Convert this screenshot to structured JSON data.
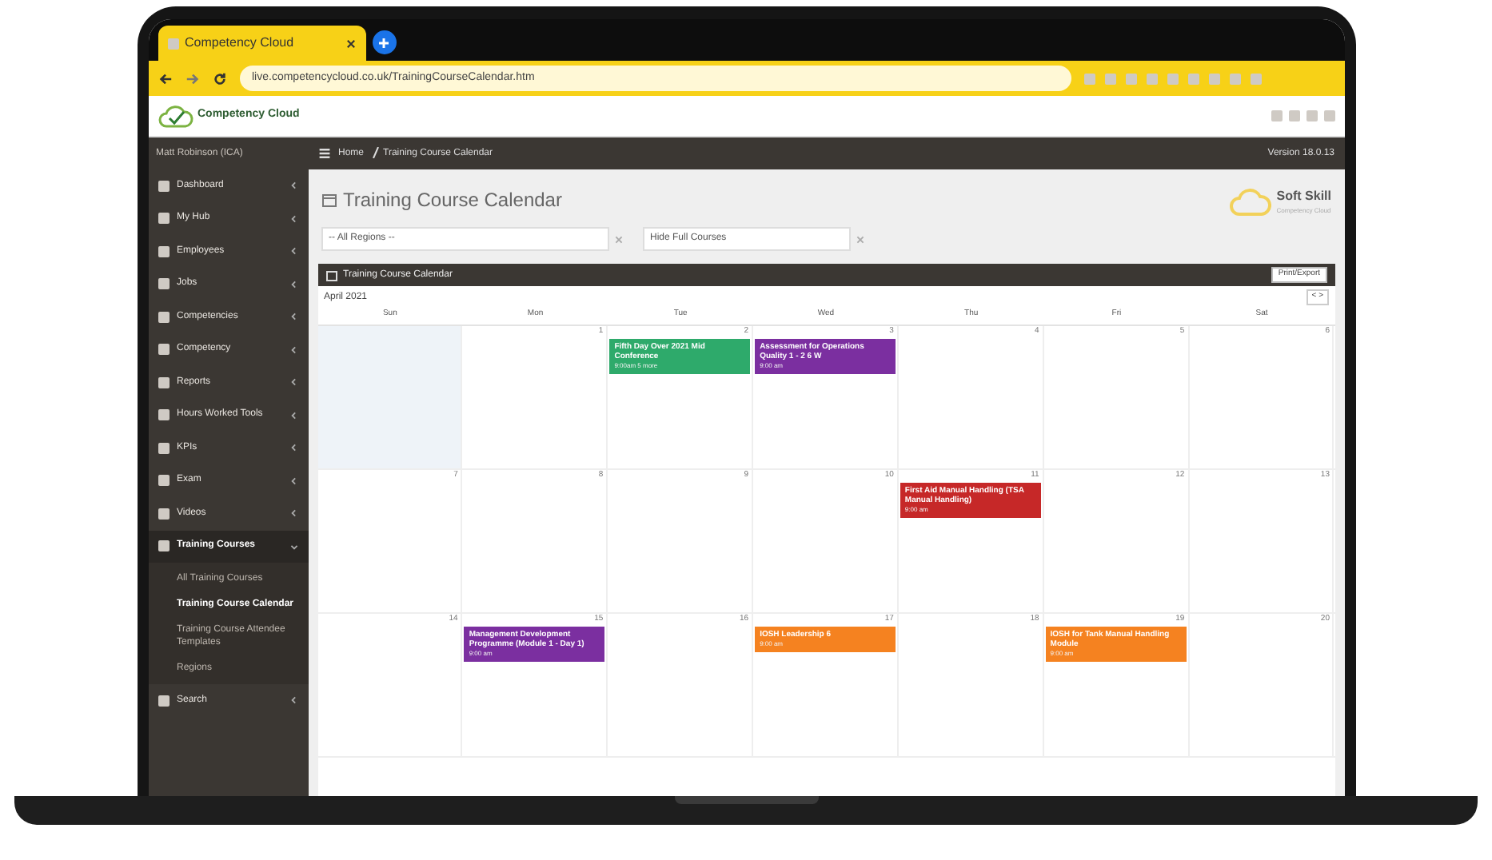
{
  "browser": {
    "tab_title": "Competency Cloud",
    "url": "live.competencycloud.co.uk/TrainingCourseCalendar.htm"
  },
  "app": {
    "logo_text": "Competency Cloud"
  },
  "sidebar": {
    "user": "Matt Robinson (ICA)",
    "items": [
      {
        "label": "Dashboard",
        "selected": false,
        "expanded": false
      },
      {
        "label": "My Hub",
        "selected": false,
        "expanded": false
      },
      {
        "label": "Employees",
        "selected": false,
        "expanded": false
      },
      {
        "label": "Jobs",
        "selected": false,
        "expanded": false
      },
      {
        "label": "Competencies",
        "selected": false,
        "expanded": false
      },
      {
        "label": "Competency",
        "selected": false,
        "expanded": false
      },
      {
        "label": "Reports",
        "selected": false,
        "expanded": false
      },
      {
        "label": "Hours Worked Tools",
        "selected": false,
        "expanded": false
      },
      {
        "label": "KPIs",
        "selected": false,
        "expanded": false
      },
      {
        "label": "Exam",
        "selected": false,
        "expanded": false
      },
      {
        "label": "Videos",
        "selected": false,
        "expanded": false
      },
      {
        "label": "Training Courses",
        "selected": true,
        "expanded": true,
        "children": [
          {
            "label": "All Training Courses",
            "selected": false
          },
          {
            "label": "Training Course Calendar",
            "selected": true
          },
          {
            "label": "Training Course Attendee Templates",
            "selected": false
          },
          {
            "label": "Regions",
            "selected": false
          }
        ]
      },
      {
        "label": "Search",
        "selected": false,
        "expanded": false
      }
    ]
  },
  "header": {
    "breadcrumb": [
      "Home",
      "Training Course Calendar"
    ],
    "version": "Version 18.0.13"
  },
  "page_title": "Training Course Calendar",
  "brand": {
    "name": "Soft Skill",
    "tagline": "Competency Cloud"
  },
  "filters": [
    {
      "value": "-- All Regions --"
    },
    {
      "value": "Hide Full Courses"
    }
  ],
  "panel": {
    "title": "Training Course Calendar",
    "button": "Print/Export",
    "month": "April 2021",
    "nav": "< >",
    "days": [
      "Sun",
      "Mon",
      "Tue",
      "Wed",
      "Thu",
      "Fri",
      "Sat"
    ],
    "weeks": [
      {
        "days": [
          {
            "other_month": true
          },
          {
            "date": "1",
            "other_month": false
          },
          {
            "date": "2",
            "other_month": false,
            "events": [
              {
                "title": "Fifth Day Over 2021 Mid Conference",
                "time": "9:00am 5 more",
                "color": "#2eaa6b"
              }
            ]
          },
          {
            "date": "3",
            "other_month": false,
            "events": [
              {
                "title": "Assessment for Operations Quality 1 - 2 6 W",
                "time": "9:00 am",
                "color": "#7b2fa0"
              }
            ]
          },
          {
            "date": "4",
            "other_month": false
          },
          {
            "date": "5",
            "other_month": false
          },
          {
            "date": "6",
            "other_month": false
          }
        ]
      },
      {
        "days": [
          {
            "date": "7",
            "other_month": false
          },
          {
            "date": "8",
            "other_month": false
          },
          {
            "date": "9",
            "other_month": false
          },
          {
            "date": "10",
            "other_month": false
          },
          {
            "date": "11",
            "other_month": false,
            "events": [
              {
                "title": "First Aid Manual Handling (TSA Manual Handling)",
                "time": "9:00 am",
                "color": "#c62828"
              }
            ]
          },
          {
            "date": "12",
            "other_month": false
          },
          {
            "date": "13",
            "other_month": false
          }
        ]
      },
      {
        "days": [
          {
            "date": "14",
            "other_month": false
          },
          {
            "date": "15",
            "other_month": false,
            "events": [
              {
                "title": "Management Development Programme (Module 1 - Day 1)",
                "time": "9:00 am",
                "color": "#7b2fa0"
              }
            ]
          },
          {
            "date": "16",
            "other_month": false
          },
          {
            "date": "17",
            "other_month": false,
            "events": [
              {
                "title": "IOSH Leadership 6",
                "time": "9:00 am",
                "color": "#f58220"
              }
            ]
          },
          {
            "date": "18",
            "other_month": false
          },
          {
            "date": "19",
            "other_month": false,
            "events": [
              {
                "title": "IOSH for Tank Manual Handling Module",
                "time": "9:00 am",
                "color": "#f58220"
              }
            ]
          },
          {
            "date": "20",
            "other_month": false
          }
        ]
      }
    ]
  }
}
